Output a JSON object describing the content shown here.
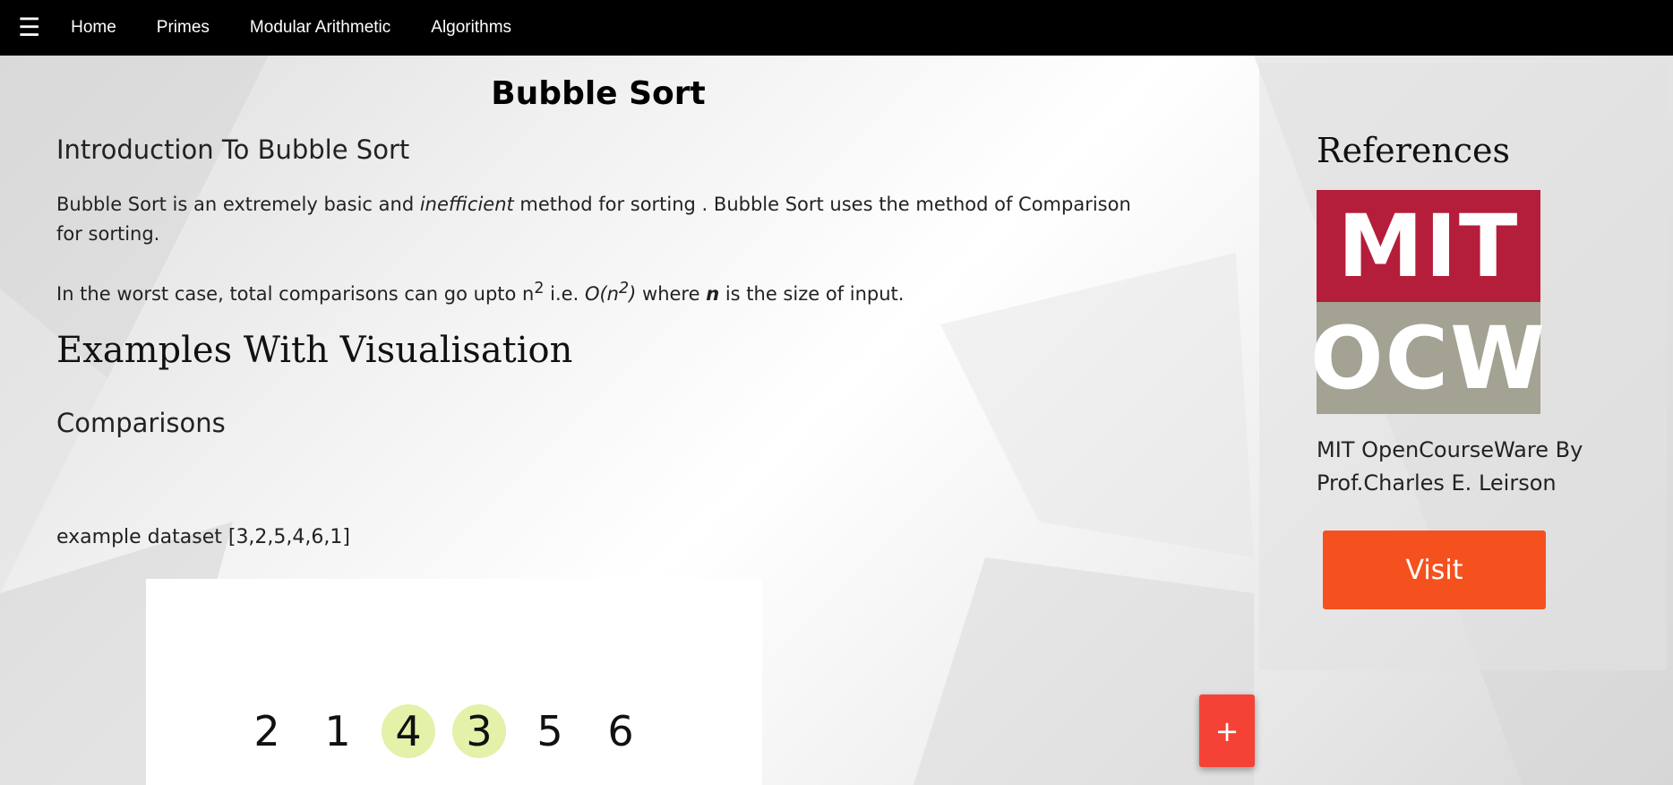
{
  "nav": {
    "menu_icon": "☰",
    "links": [
      "Home",
      "Primes",
      "Modular Arithmetic",
      "Algorithms"
    ]
  },
  "main": {
    "title": "Bubble Sort",
    "intro_heading": "Introduction To Bubble Sort",
    "intro_p1": {
      "before": "Bubble Sort is an extremely basic and ",
      "em": "inefficient",
      "after": " method for sorting . Bubble Sort uses the method of Comparison for sorting."
    },
    "intro_p2": {
      "t1": "In the worst case, total comparisons can go upto n",
      "sup1": "2",
      "t2": " i.e. ",
      "big_o": "O(n",
      "sup2": "2",
      "close": ")",
      "t3": " where ",
      "n": "n",
      "t4": " is the size of input."
    },
    "examples_heading": "Examples With Visualisation",
    "comparisons_heading": "Comparisons",
    "dataset_label": "example dataset [3,2,5,4,6,1]",
    "visualization": {
      "numbers": [
        "2",
        "1",
        "4",
        "3",
        "5",
        "6"
      ],
      "highlighted": [
        2,
        3
      ],
      "highlight_color": "#e3f1a9"
    },
    "fab_label": "+"
  },
  "aside": {
    "heading": "References",
    "logo": {
      "line1": "MIT",
      "line2": "OCW",
      "top_color": "#b51e3b",
      "bottom_color": "#a3a293"
    },
    "description": "MIT OpenCourseWare By Prof.Charles E. Leirson",
    "visit_label": "Visit"
  },
  "colors": {
    "topbar": "#000000",
    "visit_button": "#f4511e",
    "fab": "#f44336"
  }
}
